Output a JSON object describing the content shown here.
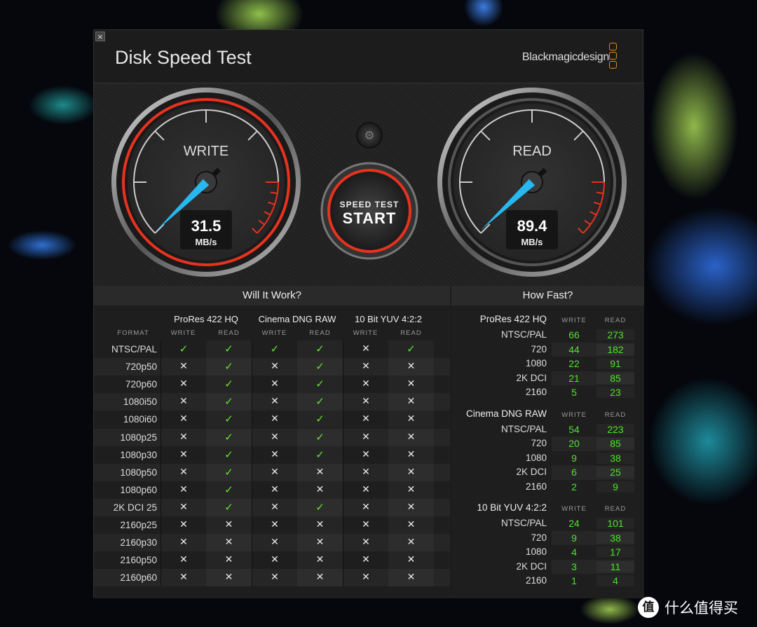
{
  "window": {
    "title": "Disk Speed Test",
    "brand": "Blackmagicdesign",
    "close": "×"
  },
  "gauges": {
    "write": {
      "label": "WRITE",
      "value": "31.5",
      "unit": "MB/s"
    },
    "read": {
      "label": "READ",
      "value": "89.4",
      "unit": "MB/s"
    },
    "start_button": {
      "line1": "SPEED TEST",
      "line2": "START"
    },
    "settings_icon": "gear-icon"
  },
  "will_it_work": {
    "title": "Will It Work?",
    "format_header": "FORMAT",
    "codecs": [
      {
        "name": "ProRes 422 HQ",
        "write": "WRITE",
        "read": "READ"
      },
      {
        "name": "Cinema DNG RAW",
        "write": "WRITE",
        "read": "READ"
      },
      {
        "name": "10 Bit YUV 4:2:2",
        "write": "WRITE",
        "read": "READ"
      }
    ],
    "rows": [
      {
        "format": "NTSC/PAL",
        "marks": [
          1,
          1,
          1,
          1,
          0,
          1
        ]
      },
      {
        "format": "720p50",
        "marks": [
          0,
          1,
          0,
          1,
          0,
          0
        ]
      },
      {
        "format": "720p60",
        "marks": [
          0,
          1,
          0,
          1,
          0,
          0
        ]
      },
      {
        "format": "1080i50",
        "marks": [
          0,
          1,
          0,
          1,
          0,
          0
        ]
      },
      {
        "format": "1080i60",
        "marks": [
          0,
          1,
          0,
          1,
          0,
          0
        ]
      },
      {
        "format": "1080p25",
        "marks": [
          0,
          1,
          0,
          1,
          0,
          0
        ]
      },
      {
        "format": "1080p30",
        "marks": [
          0,
          1,
          0,
          1,
          0,
          0
        ]
      },
      {
        "format": "1080p50",
        "marks": [
          0,
          1,
          0,
          0,
          0,
          0
        ]
      },
      {
        "format": "1080p60",
        "marks": [
          0,
          1,
          0,
          0,
          0,
          0
        ]
      },
      {
        "format": "2K DCI 25",
        "marks": [
          0,
          1,
          0,
          1,
          0,
          0
        ]
      },
      {
        "format": "2160p25",
        "marks": [
          0,
          0,
          0,
          0,
          0,
          0
        ]
      },
      {
        "format": "2160p30",
        "marks": [
          0,
          0,
          0,
          0,
          0,
          0
        ]
      },
      {
        "format": "2160p50",
        "marks": [
          0,
          0,
          0,
          0,
          0,
          0
        ]
      },
      {
        "format": "2160p60",
        "marks": [
          0,
          0,
          0,
          0,
          0,
          0
        ]
      }
    ],
    "check": "✓",
    "cross": "✕"
  },
  "how_fast": {
    "title": "How Fast?",
    "groups": [
      {
        "name": "ProRes 422 HQ",
        "write": "WRITE",
        "read": "READ",
        "rows": [
          {
            "f": "NTSC/PAL",
            "w": "66",
            "r": "273"
          },
          {
            "f": "720",
            "w": "44",
            "r": "182"
          },
          {
            "f": "1080",
            "w": "22",
            "r": "91"
          },
          {
            "f": "2K DCI",
            "w": "21",
            "r": "85"
          },
          {
            "f": "2160",
            "w": "5",
            "r": "23"
          }
        ]
      },
      {
        "name": "Cinema DNG RAW",
        "write": "WRITE",
        "read": "READ",
        "rows": [
          {
            "f": "NTSC/PAL",
            "w": "54",
            "r": "223"
          },
          {
            "f": "720",
            "w": "20",
            "r": "85"
          },
          {
            "f": "1080",
            "w": "9",
            "r": "38"
          },
          {
            "f": "2K DCI",
            "w": "6",
            "r": "25"
          },
          {
            "f": "2160",
            "w": "2",
            "r": "9"
          }
        ]
      },
      {
        "name": "10 Bit YUV 4:2:2",
        "write": "WRITE",
        "read": "READ",
        "rows": [
          {
            "f": "NTSC/PAL",
            "w": "24",
            "r": "101"
          },
          {
            "f": "720",
            "w": "9",
            "r": "38"
          },
          {
            "f": "1080",
            "w": "4",
            "r": "17"
          },
          {
            "f": "2K DCI",
            "w": "3",
            "r": "11"
          },
          {
            "f": "2160",
            "w": "1",
            "r": "4"
          }
        ]
      }
    ]
  },
  "watermark": {
    "logo": "值",
    "text": "什么值得买"
  },
  "colors": {
    "ok": "#5ee82b",
    "needle": "#27b8f0",
    "redzone": "#e8321e",
    "logo": "#e08a1e"
  }
}
